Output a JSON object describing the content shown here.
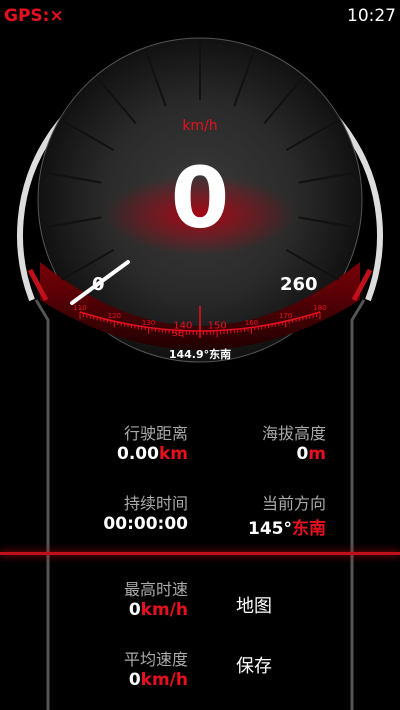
{
  "status": {
    "gps": "GPS:×",
    "time": "10:27"
  },
  "gauge": {
    "unit": "km/h",
    "speed": "0",
    "min": "0",
    "max": "260",
    "heading_text": "144.9°东南",
    "compass_labels": [
      "110",
      "120",
      "130",
      "140",
      "150",
      "160",
      "170",
      "180"
    ],
    "compass_dir": "SE"
  },
  "stats": {
    "distance": {
      "label": "行驶距离",
      "value": "0.00",
      "unit": "km"
    },
    "altitude": {
      "label": "海拔高度",
      "value": "0",
      "unit": "m"
    },
    "duration": {
      "label": "持续时间",
      "value": "00:00:00"
    },
    "direction": {
      "label": "当前方向",
      "value": "145°",
      "unit": "东南"
    },
    "max_speed": {
      "label": "最高时速",
      "value": "0",
      "unit": "km/h"
    },
    "avg_speed": {
      "label": "平均速度",
      "value": "0",
      "unit": "km/h"
    }
  },
  "actions": {
    "map": "地图",
    "save": "保存"
  },
  "colors": {
    "accent": "#e8101e",
    "background": "#000000"
  }
}
